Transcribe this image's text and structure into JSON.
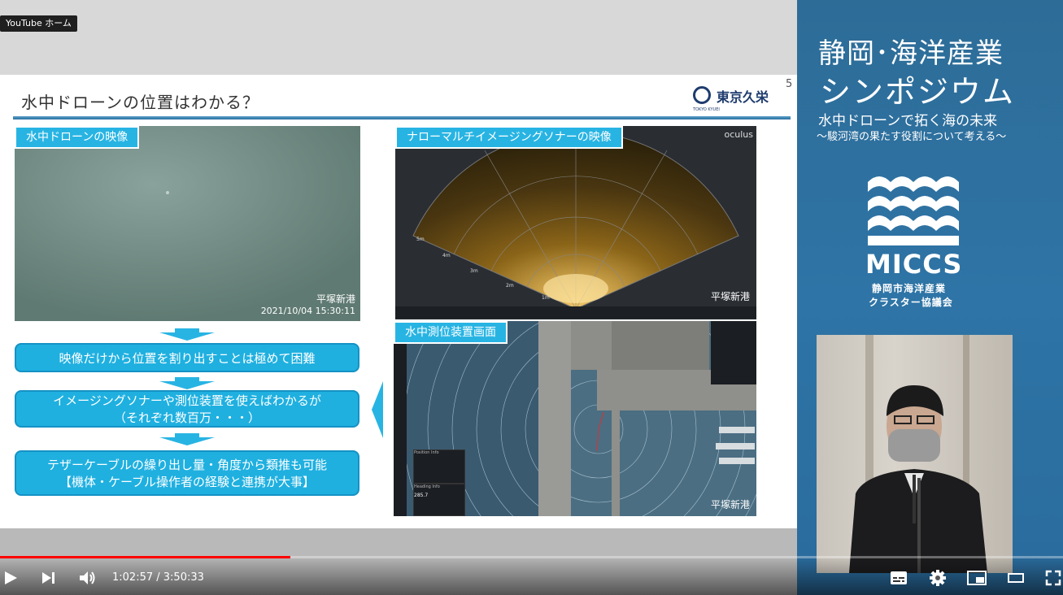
{
  "overlay": {
    "youtube_home": "YouTube ホーム"
  },
  "slide": {
    "title": "水中ドローンの位置はわかる？",
    "page_number": "5",
    "logo": {
      "name": "東京久栄",
      "sub": "TOKYO KYUEI"
    },
    "drone_video": {
      "label": "水中ドローンの映像",
      "stamp_place": "平塚新港",
      "stamp_time": "2021/10/04 15:30:11"
    },
    "boxes": [
      {
        "line1": "映像だけから位置を割り出すことは極めて困難",
        "line2": ""
      },
      {
        "line1": "イメージングソナーや測位装置を使えばわかるが",
        "line2": "（それぞれ数百万・・・）"
      },
      {
        "line1": "テザーケーブルの繰り出し量・角度から類推も可能",
        "line2": "【機体・ケーブル操作者の経験と連携が大事】"
      }
    ],
    "sonar": {
      "label": "ナローマルチイメージングソナーの映像",
      "brand": "oculus",
      "stamp_place": "平塚新港",
      "range_labels": [
        "5m",
        "4m",
        "3m",
        "2m",
        "1m"
      ]
    },
    "positioning": {
      "label": "水中測位装置画面",
      "stamp_place": "平塚新港",
      "panel_titles": [
        "Position Info",
        "Heading Info"
      ],
      "heading_value": "285.7"
    }
  },
  "sidebar": {
    "title_line1": "静岡･海洋産業",
    "title_line2": "シンポジウム",
    "subtitle": "水中ドローンで拓く海の未来",
    "subtitle2": "～駿河湾の果たす役割について考える～",
    "org_name": "MICCS",
    "org_jp1": "静岡市海洋産業",
    "org_jp2": "クラスター協議会"
  },
  "player": {
    "current_time": "1:02:57",
    "duration": "3:50:33",
    "time_separator": " / ",
    "progress_fraction": 0.273
  },
  "colors": {
    "accent": "#28b4e3",
    "progress": "#ff0000",
    "sidebar_bg": "#2e74a6"
  }
}
